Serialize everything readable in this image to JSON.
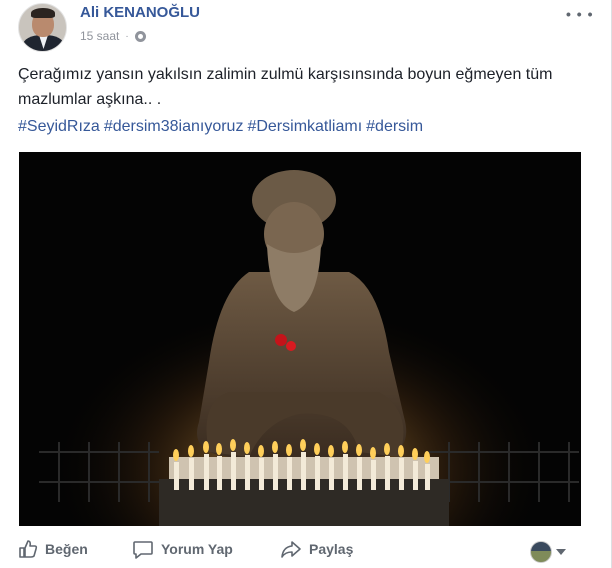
{
  "post": {
    "author": "Ali KENANOĞLU",
    "time": "15 saat",
    "separator": "·",
    "text": "Çerağımız yansın yakılsın zalimin zulmü karşısınsında boyun eğmeyen tüm mazlumlar aşkına.. .",
    "hashtags": [
      "#SeyidRıza",
      "#dersim38ianıyoruz",
      "#Dersimkatliamı",
      "#dersim"
    ],
    "privacy_icon": "globe-icon",
    "more_icon": "more-options-icon"
  },
  "actions": {
    "like": "Beğen",
    "comment": "Yorum Yap",
    "share": "Paylaş"
  },
  "colors": {
    "link": "#365899",
    "text": "#1d2129",
    "meta": "#90949c",
    "action": "#606770"
  }
}
